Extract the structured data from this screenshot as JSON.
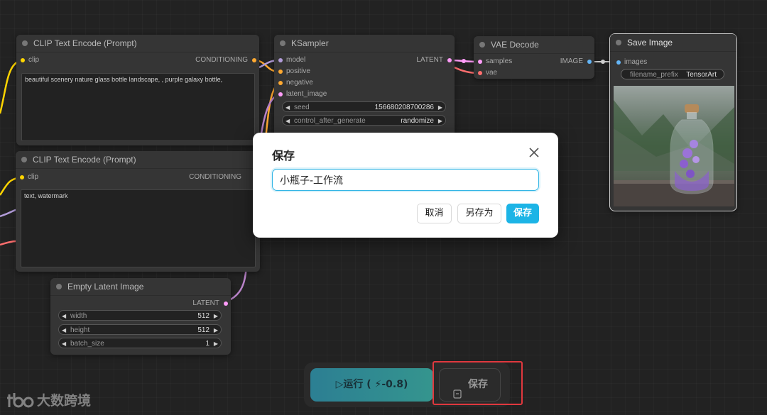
{
  "colors": {
    "canvas_bg": "#222222",
    "node_bg": "#353535",
    "conditioning": "#ffa931",
    "clip": "#ffd500",
    "model": "#b39ddb",
    "latent": "#ff9cf9",
    "vae": "#ff6e6e",
    "image": "#64b5f6",
    "accent": "#1cb4e6",
    "highlight": "#e0383e"
  },
  "nodes": {
    "clip_positive": {
      "title": "CLIP Text Encode (Prompt)",
      "input_clip": "clip",
      "output_conditioning": "CONDITIONING",
      "text": "beautiful scenery nature glass bottle landscape, , purple galaxy bottle,"
    },
    "clip_negative": {
      "title": "CLIP Text Encode (Prompt)",
      "input_clip": "clip",
      "output_conditioning": "CONDITIONING",
      "text": "text, watermark"
    },
    "ksampler": {
      "title": "KSampler",
      "inputs": [
        "model",
        "positive",
        "negative",
        "latent_image"
      ],
      "output_latent": "LATENT",
      "widgets": [
        {
          "name": "seed",
          "value": "156680208700286"
        },
        {
          "name": "control_after_generate",
          "value": "randomize"
        }
      ]
    },
    "vae_decode": {
      "title": "VAE Decode",
      "inputs": [
        "samples",
        "vae"
      ],
      "output_image": "IMAGE"
    },
    "save_image": {
      "title": "Save Image",
      "input_images": "images",
      "widget_name": "filename_prefix",
      "widget_value": "TensorArt"
    },
    "empty_latent": {
      "title": "Empty Latent Image",
      "output_latent": "LATENT",
      "widgets": [
        {
          "name": "width",
          "value": "512"
        },
        {
          "name": "height",
          "value": "512"
        },
        {
          "name": "batch_size",
          "value": "1"
        }
      ]
    }
  },
  "dialog": {
    "title": "保存",
    "input_value": "小瓶子-工作流",
    "cancel_label": "取消",
    "save_as_label": "另存为",
    "save_label": "保存"
  },
  "toolbar": {
    "run_label": "▷运行 ( ⚡-0.8)",
    "save_label": "保存"
  },
  "watermark": {
    "logo_text": "tbo",
    "text": "大数跨境"
  }
}
